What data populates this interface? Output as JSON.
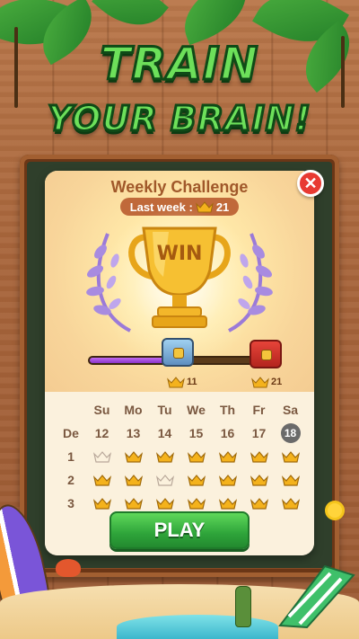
{
  "title": {
    "line1": "TRAIN",
    "line2": "YOUR BRAIN!"
  },
  "dialog": {
    "title": "Weekly Challenge",
    "last_week_label": "Last week :",
    "last_week_value": "21",
    "close_icon": "close-icon",
    "trophy_text": "WIN"
  },
  "progress": {
    "fraction": 0.42,
    "milestones": [
      {
        "value": "11",
        "icon": "crown-icon"
      },
      {
        "value": "21",
        "icon": "crown-icon"
      }
    ]
  },
  "calendar": {
    "days": [
      "Su",
      "Mo",
      "Tu",
      "We",
      "Th",
      "Fr",
      "Sa"
    ],
    "date_row_label": "De",
    "dates": [
      "12",
      "13",
      "14",
      "15",
      "16",
      "17",
      "18"
    ],
    "today": "18",
    "rows": [
      {
        "label": "1",
        "crowns": [
          "empty",
          "gold",
          "gold",
          "gold",
          "gold",
          "gold",
          "gold"
        ]
      },
      {
        "label": "2",
        "crowns": [
          "gold",
          "gold",
          "empty",
          "gold",
          "gold",
          "gold",
          "gold"
        ]
      },
      {
        "label": "3",
        "crowns": [
          "gold",
          "gold",
          "gold",
          "gold",
          "gold",
          "gold",
          "gold"
        ]
      }
    ]
  },
  "play_button": {
    "label": "PLAY"
  },
  "colors": {
    "title_green": "#6de05a",
    "dialog_title": "#a0582a",
    "play_green": "#2ea43a",
    "progress_purple": "#8b34c9",
    "crown_gold": "#f4b21c"
  }
}
